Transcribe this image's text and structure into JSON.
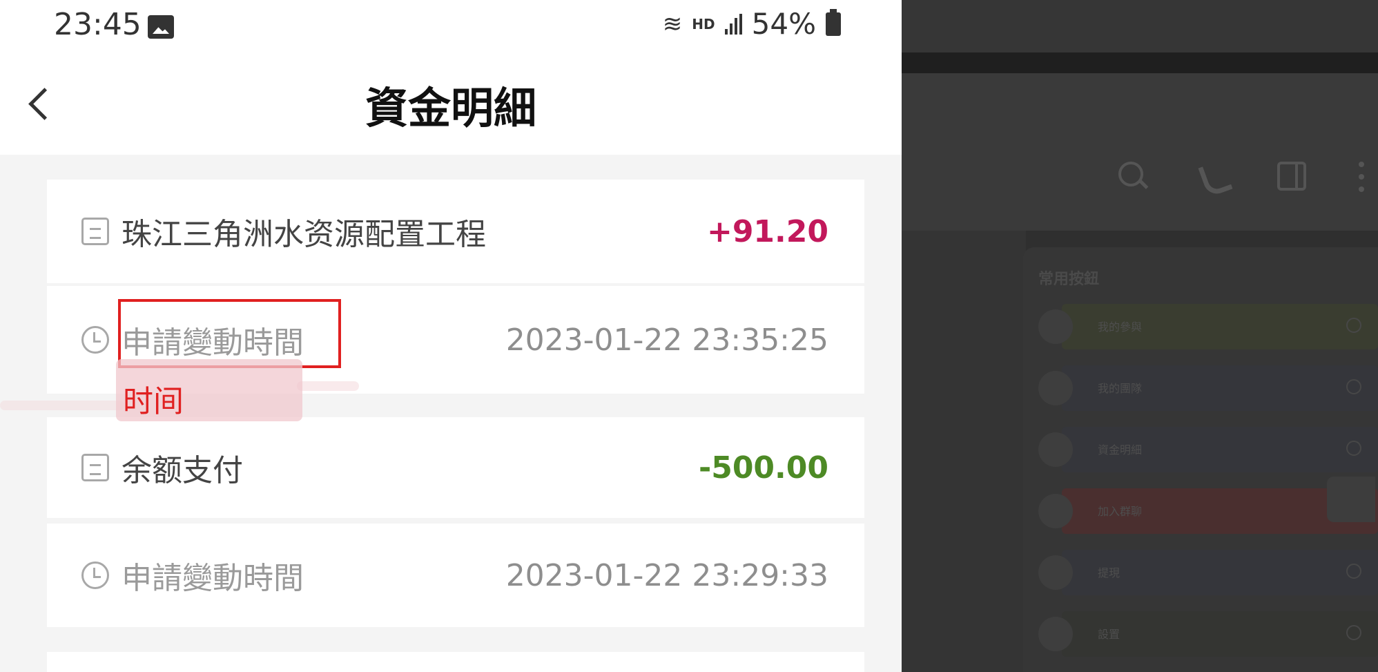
{
  "status_bar": {
    "time": "23:45",
    "image_icon": "image-notification-icon",
    "wifi_icon": "wifi-icon",
    "network_label": "HD",
    "signal_icon": "signal-bars-icon",
    "battery_percent": "54%",
    "battery_icon": "battery-icon"
  },
  "header": {
    "back_icon": "back-arrow-icon",
    "title": "資金明細"
  },
  "records": [
    {
      "icon": "document-icon",
      "label": "珠江三角洲水资源配置工程",
      "value": "+91.20",
      "value_color": "#c2185b"
    },
    {
      "icon": "clock-icon",
      "label": "申請變動時間",
      "value": "2023-01-22 23:35:25"
    },
    {
      "icon": "document-icon",
      "label": "余额支付",
      "value": "-500.00",
      "value_color": "#4d8a25"
    },
    {
      "icon": "clock-icon",
      "label": "申請變動時間",
      "value": "2023-01-22 23:29:33"
    }
  ],
  "annotation": {
    "text": "时间",
    "color": "#e02020"
  },
  "side_panel": {
    "toolbar_icons": [
      "search-icon",
      "phone-icon",
      "split-view-icon",
      "more-icon"
    ],
    "card_title": "常用按鈕",
    "items": [
      {
        "icon": "tasks-icon",
        "label": "我的參與",
        "color": "#3a3d30"
      },
      {
        "icon": "team-icon",
        "label": "我的團隊",
        "color": "#35363b"
      },
      {
        "icon": "funds-icon",
        "label": "資金明細",
        "color": "#35363b"
      },
      {
        "icon": "chat-icon",
        "label": "加入群聊",
        "color": "#4a2f2f"
      },
      {
        "icon": "search-doc-icon",
        "label": "提現",
        "color": "#35363b"
      },
      {
        "icon": "settings-icon",
        "label": "設置",
        "color": "#343532"
      }
    ]
  },
  "colors": {
    "positive": "#c2185b",
    "negative": "#4d8a25",
    "highlight": "#e02020"
  }
}
